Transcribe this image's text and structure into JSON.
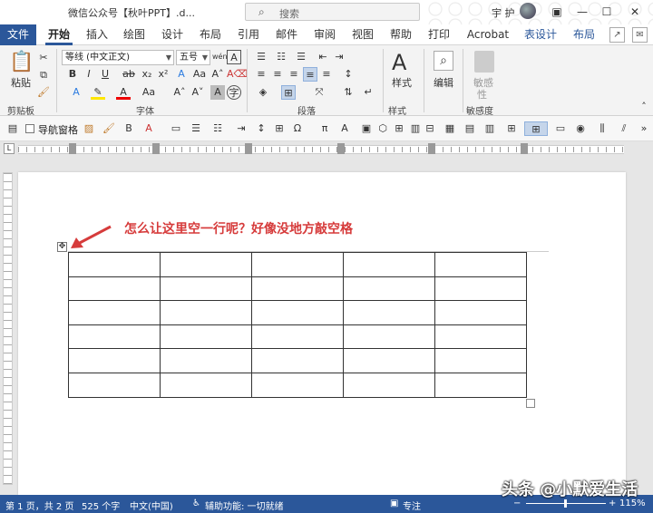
{
  "titlebar": {
    "doc_title": "微信公众号【秋叶PPT】.d...",
    "search_placeholder": "搜索",
    "user": "宇 护"
  },
  "tabs": [
    "文件",
    "开始",
    "插入",
    "绘图",
    "设计",
    "布局",
    "引用",
    "邮件",
    "审阅",
    "视图",
    "帮助",
    "打印",
    "Acrobat",
    "表设计",
    "布局"
  ],
  "ribbon": {
    "clipboard": {
      "paste": "粘贴",
      "label": "剪贴板"
    },
    "font": {
      "name": "等线 (中文正文)",
      "size": "五号",
      "label": "字体"
    },
    "paragraph": {
      "label": "段落"
    },
    "styles": {
      "button": "样式",
      "label": "样式"
    },
    "editing": {
      "button": "编辑"
    },
    "sensitivity": {
      "button_line1": "敏感",
      "button_line2": "性",
      "label": "敏感度"
    }
  },
  "qat": {
    "nav_pane": "导航窗格"
  },
  "annotation": "怎么让这里空一行呢？好像没地方敲空格",
  "table": {
    "rows": 6,
    "cols": 5
  },
  "status": {
    "page": "第 1 页，共 2 页",
    "words": "525 个字",
    "lang": "中文(中国)",
    "accessibility": "辅助功能: 一切就绪",
    "focus": "专注",
    "zoom": "115%"
  },
  "watermark": "头条 @小默爱生活",
  "colors": {
    "accent": "#2b579a",
    "annotation": "#d63b3b"
  }
}
